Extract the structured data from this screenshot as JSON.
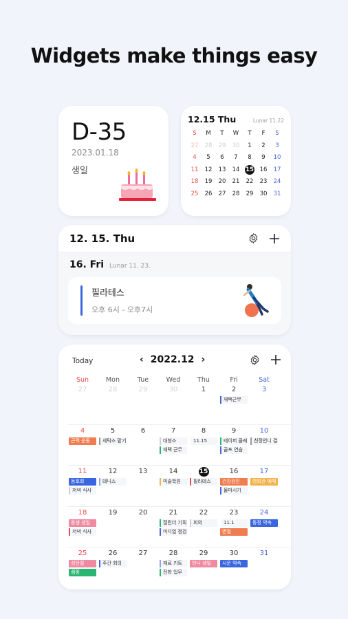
{
  "headline": "Widgets make things easy",
  "dday": {
    "count": "D-35",
    "date": "2023.01.18",
    "label": "생일"
  },
  "mini_calendar": {
    "title": "12.15 Thu",
    "lunar": "Lunar 11.22",
    "weekdays": [
      "S",
      "M",
      "T",
      "W",
      "T",
      "F",
      "S"
    ],
    "weeks": [
      [
        "27",
        "28",
        "29",
        "30",
        "1",
        "2",
        "3"
      ],
      [
        "4",
        "5",
        "6",
        "7",
        "8",
        "9",
        "10"
      ],
      [
        "11",
        "12",
        "13",
        "14",
        "15",
        "16",
        "17"
      ],
      [
        "18",
        "19",
        "20",
        "21",
        "22",
        "23",
        "24"
      ],
      [
        "25",
        "26",
        "27",
        "28",
        "29",
        "30",
        "31"
      ]
    ],
    "today": "15"
  },
  "agenda": {
    "header_date": "12. 15. Thu",
    "day": "16. Fri",
    "lunar": "Lunar 11. 23.",
    "event_title": "필라테스",
    "event_time": "오후 6시 - 오후7시",
    "event_color": "#3a67e0"
  },
  "month": {
    "today_label": "Today",
    "prev": "‹",
    "title": "2022.12",
    "next": "›",
    "weekdays": [
      "Sun",
      "Mon",
      "Tue",
      "Wed",
      "Thu",
      "Fri",
      "Sat"
    ],
    "weeks": [
      [
        {
          "d": "27",
          "events": []
        },
        {
          "d": "28",
          "events": []
        },
        {
          "d": "29",
          "events": []
        },
        {
          "d": "30",
          "events": []
        },
        {
          "d": "1",
          "events": []
        },
        {
          "d": "2",
          "events": [
            {
              "t": "재택근무",
              "style": "line",
              "color": "#4865d8"
            }
          ]
        },
        {
          "d": "3",
          "events": []
        }
      ],
      [
        {
          "d": "4",
          "events": [
            {
              "t": "근력 운동",
              "style": "fill",
              "color": "#ef7d4f"
            }
          ]
        },
        {
          "d": "5",
          "events": [
            {
              "t": "세탁소 맡기",
              "style": "line",
              "color": "#999999"
            }
          ]
        },
        {
          "d": "6",
          "events": []
        },
        {
          "d": "7",
          "events": [
            {
              "t": "대청소",
              "style": "line",
              "color": "#cfcfcf"
            },
            {
              "t": "재택 근무",
              "style": "line",
              "color": "#2bb573"
            }
          ]
        },
        {
          "d": "8",
          "events": [
            {
              "t": "11.15",
              "style": "line",
              "color": "#ffffff"
            }
          ]
        },
        {
          "d": "9",
          "events": [
            {
              "t": "테이퍼 클래스",
              "style": "line",
              "color": "#2bb573"
            },
            {
              "t": "골프 연습",
              "style": "line",
              "color": "#4865d8"
            }
          ]
        },
        {
          "d": "10",
          "events": [
            {
              "t": "친정언니 결혼식",
              "style": "line",
              "color": "#999999"
            }
          ]
        }
      ],
      [
        {
          "d": "11",
          "events": [
            {
              "t": "동호회",
              "style": "fill",
              "color": "#3a67e0"
            },
            {
              "t": "저녁 식사",
              "style": "line",
              "color": "#cfcfcf"
            }
          ]
        },
        {
          "d": "12",
          "events": [
            {
              "t": "테니스",
              "style": "line",
              "color": "#8aa4ee"
            }
          ]
        },
        {
          "d": "13",
          "events": []
        },
        {
          "d": "14",
          "events": [
            {
              "t": "미술학원",
              "style": "line",
              "color": "#f2b34a"
            }
          ]
        },
        {
          "d": "15",
          "events": [
            {
              "t": "필라테스",
              "style": "line",
              "color": "#e84d4d"
            }
          ]
        },
        {
          "d": "16",
          "events": [
            {
              "t": "건강검진",
              "style": "fill",
              "color": "#ef7d4f"
            },
            {
              "t": "물마시기",
              "style": "line",
              "color": "#4865d8"
            }
          ]
        },
        {
          "d": "17",
          "events": [
            {
              "t": "영화관 예매",
              "style": "fill",
              "color": "#f2b34a"
            }
          ]
        }
      ],
      [
        {
          "d": "18",
          "events": [
            {
              "t": "동생 생일",
              "style": "fill",
              "color": "#ef8aa0"
            },
            {
              "t": "저녁 식사",
              "style": "line",
              "color": "#e84d4d"
            }
          ]
        },
        {
          "d": "19",
          "events": []
        },
        {
          "d": "20",
          "events": []
        },
        {
          "d": "21",
          "events": [
            {
              "t": "캘린더 기획",
              "style": "line",
              "color": "#2bb573"
            },
            {
              "t": "미디업 점검",
              "style": "line",
              "color": "#4865d8"
            }
          ]
        },
        {
          "d": "22",
          "events": [
            {
              "t": "회의",
              "style": "line",
              "color": "#cfcfcf"
            }
          ]
        },
        {
          "d": "23",
          "events": [
            {
              "t": "11.1",
              "style": "line",
              "color": "#ffffff"
            },
            {
              "t": "면접",
              "style": "fill",
              "color": "#ef7d4f"
            }
          ]
        },
        {
          "d": "24",
          "events": [
            {
              "t": "동정 약속",
              "style": "fill",
              "color": "#3a67e0"
            }
          ]
        }
      ],
      [
        {
          "d": "25",
          "events": [
            {
              "t": "성탄절",
              "style": "fill",
              "color": "#ef8aa0"
            },
            {
              "t": "캠핑",
              "style": "fill",
              "color": "#2bb573"
            }
          ]
        },
        {
          "d": "26",
          "events": [
            {
              "t": "주간 회의",
              "style": "line",
              "color": "#4865d8"
            }
          ]
        },
        {
          "d": "27",
          "events": []
        },
        {
          "d": "28",
          "events": [
            {
              "t": "재료 키트",
              "style": "line",
              "color": "#8aa4ee"
            },
            {
              "t": "전화 업무",
              "style": "line",
              "color": "#2bb573"
            }
          ]
        },
        {
          "d": "29",
          "events": [
            {
              "t": "언니 생일",
              "style": "fill",
              "color": "#ef8aa0"
            }
          ]
        },
        {
          "d": "30",
          "events": [
            {
              "t": "시운 약속",
              "style": "fill",
              "color": "#3a67e0"
            }
          ]
        },
        {
          "d": "31",
          "events": []
        }
      ]
    ]
  }
}
